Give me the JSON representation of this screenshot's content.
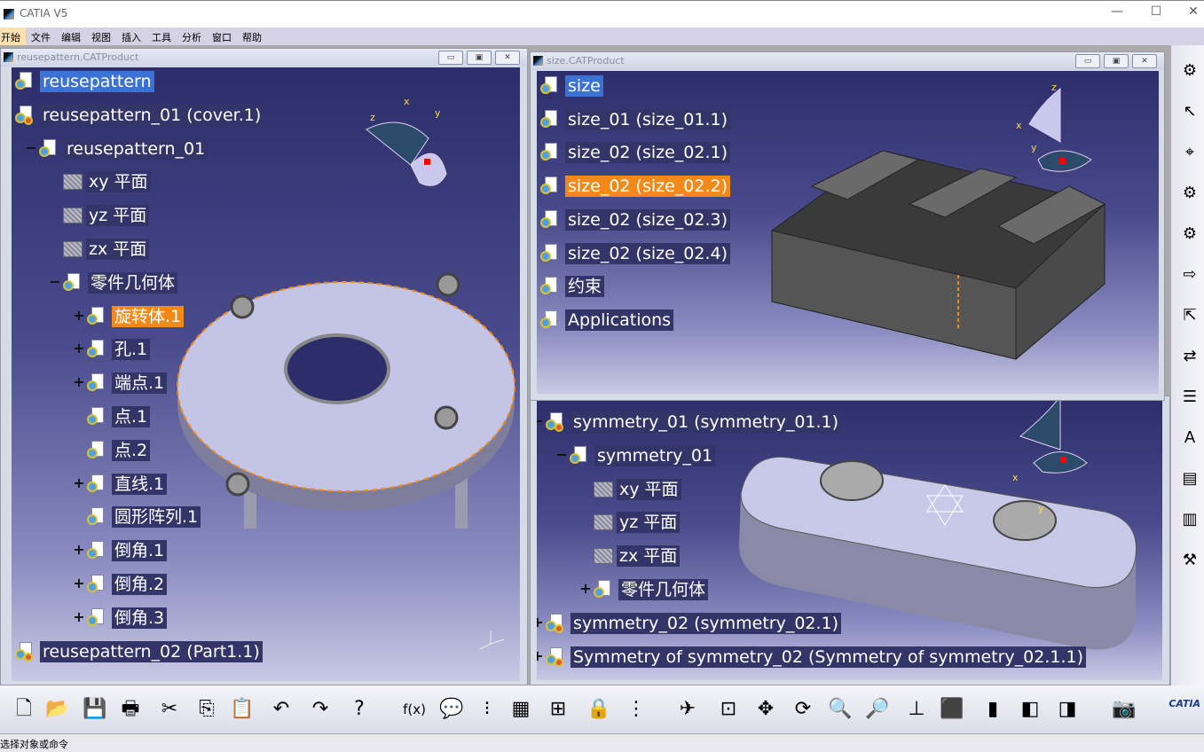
{
  "app": {
    "title": "CATIA V5",
    "minimize": "—",
    "maximize": "☐",
    "close": "✕"
  },
  "menu": [
    "开始",
    "文件",
    "编辑",
    "视图",
    "插入",
    "工具",
    "分析",
    "窗口",
    "帮助"
  ],
  "left_window": {
    "title": "reusepattern.CATProduct",
    "tree": [
      {
        "label": "reusepattern",
        "level": 0,
        "state": "root"
      },
      {
        "label": "reusepattern_01 (cover.1)",
        "level": 0,
        "expand": "minus"
      },
      {
        "label": "reusepattern_01",
        "level": 1,
        "expand": "minus"
      },
      {
        "label": "xy 平面",
        "level": 2,
        "icon": "plane"
      },
      {
        "label": "yz 平面",
        "level": 2,
        "icon": "plane"
      },
      {
        "label": "zx 平面",
        "level": 2,
        "icon": "plane"
      },
      {
        "label": "零件几何体",
        "level": 2,
        "expand": "minus",
        "icon": "body"
      },
      {
        "label": "旋转体.1",
        "level": 3,
        "expand": "plus",
        "state": "selected"
      },
      {
        "label": "孔.1",
        "level": 3,
        "expand": "plus"
      },
      {
        "label": "端点.1",
        "level": 3,
        "expand": "plus"
      },
      {
        "label": "点.1",
        "level": 3
      },
      {
        "label": "点.2",
        "level": 3
      },
      {
        "label": "直线.1",
        "level": 3,
        "expand": "plus"
      },
      {
        "label": "圆形阵列.1",
        "level": 3
      },
      {
        "label": "倒角.1",
        "level": 3,
        "expand": "plus"
      },
      {
        "label": "倒角.2",
        "level": 3,
        "expand": "plus"
      },
      {
        "label": "倒角.3",
        "level": 3,
        "expand": "plus"
      },
      {
        "label": "reusepattern_02 (Part1.1)",
        "level": 0,
        "expand": "plus"
      }
    ]
  },
  "right_top_window": {
    "title": "size.CATProduct",
    "tree": [
      {
        "label": "size",
        "level": 0,
        "state": "root"
      },
      {
        "label": "size_01 (size_01.1)",
        "level": 1,
        "expand": "plus"
      },
      {
        "label": "size_02 (size_02.1)",
        "level": 1,
        "expand": "plus"
      },
      {
        "label": "size_02 (size_02.2)",
        "level": 1,
        "expand": "plus",
        "state": "selected"
      },
      {
        "label": "size_02 (size_02.3)",
        "level": 1,
        "expand": "plus"
      },
      {
        "label": "size_02 (size_02.4)",
        "level": 1,
        "expand": "plus"
      },
      {
        "label": "约束",
        "level": 1,
        "expand": "plus"
      },
      {
        "label": "Applications",
        "level": 1
      }
    ]
  },
  "right_bottom_window": {
    "tree": [
      {
        "label": "symmetry_01 (symmetry_01.1)",
        "level": 0,
        "expand": "minus"
      },
      {
        "label": "symmetry_01",
        "level": 1,
        "expand": "minus"
      },
      {
        "label": "xy 平面",
        "level": 2,
        "icon": "plane"
      },
      {
        "label": "yz 平面",
        "level": 2,
        "icon": "plane"
      },
      {
        "label": "zx 平面",
        "level": 2,
        "icon": "plane"
      },
      {
        "label": "零件几何体",
        "level": 2,
        "expand": "plus",
        "icon": "body"
      },
      {
        "label": "symmetry_02 (symmetry_02.1)",
        "level": 0,
        "expand": "plus"
      },
      {
        "label": "Symmetry of symmetry_02 (Symmetry of symmetry_02.1.1)",
        "level": 0,
        "expand": "plus"
      }
    ]
  },
  "axes": {
    "x": "x",
    "y": "y",
    "z": "z"
  },
  "toolbar": [
    {
      "name": "new-icon",
      "glyph": "🗋"
    },
    {
      "name": "open-icon",
      "glyph": "📂"
    },
    {
      "name": "save-icon",
      "glyph": "💾"
    },
    {
      "name": "print-icon",
      "glyph": "🖶"
    },
    {
      "name": "cut-icon",
      "glyph": "✂"
    },
    {
      "name": "copy-icon",
      "glyph": "⎘"
    },
    {
      "name": "paste-icon",
      "glyph": "📋"
    },
    {
      "name": "undo-icon",
      "glyph": "↶"
    },
    {
      "name": "redo-icon",
      "glyph": "↷"
    },
    {
      "name": "whats-this-icon",
      "glyph": "?"
    },
    {
      "name": "formula-icon",
      "glyph": "f(x)"
    },
    {
      "name": "comment-icon",
      "glyph": "💬"
    },
    {
      "name": "link-icon",
      "glyph": "⁝"
    },
    {
      "name": "table-icon",
      "glyph": "▦"
    },
    {
      "name": "graph-tree-icon",
      "glyph": "⊞"
    },
    {
      "name": "lock-icon",
      "glyph": "🔒"
    },
    {
      "name": "catalog-icon",
      "glyph": "⋮"
    },
    {
      "name": "fly-icon",
      "glyph": "✈"
    },
    {
      "name": "fit-all-icon",
      "glyph": "⊡"
    },
    {
      "name": "pan-icon",
      "glyph": "✥"
    },
    {
      "name": "rotate-icon",
      "glyph": "⟳"
    },
    {
      "name": "zoom-in-icon",
      "glyph": "🔍"
    },
    {
      "name": "zoom-out-icon",
      "glyph": "🔎"
    },
    {
      "name": "normal-view-icon",
      "glyph": "⊥"
    },
    {
      "name": "iso-view-icon",
      "glyph": "⬛"
    },
    {
      "name": "shading-icon",
      "glyph": "▮"
    },
    {
      "name": "hide-show-icon",
      "glyph": "◧"
    },
    {
      "name": "swap-space-icon",
      "glyph": "◨"
    },
    {
      "name": "capture-icon",
      "glyph": "📷"
    }
  ],
  "status": "选择对象或命令",
  "brand": "CATIA",
  "colors": {
    "selected": "#f28a1a",
    "root": "#3a72d6",
    "background_top": "#2c2d6a",
    "background_bottom": "#c8c9e4"
  }
}
